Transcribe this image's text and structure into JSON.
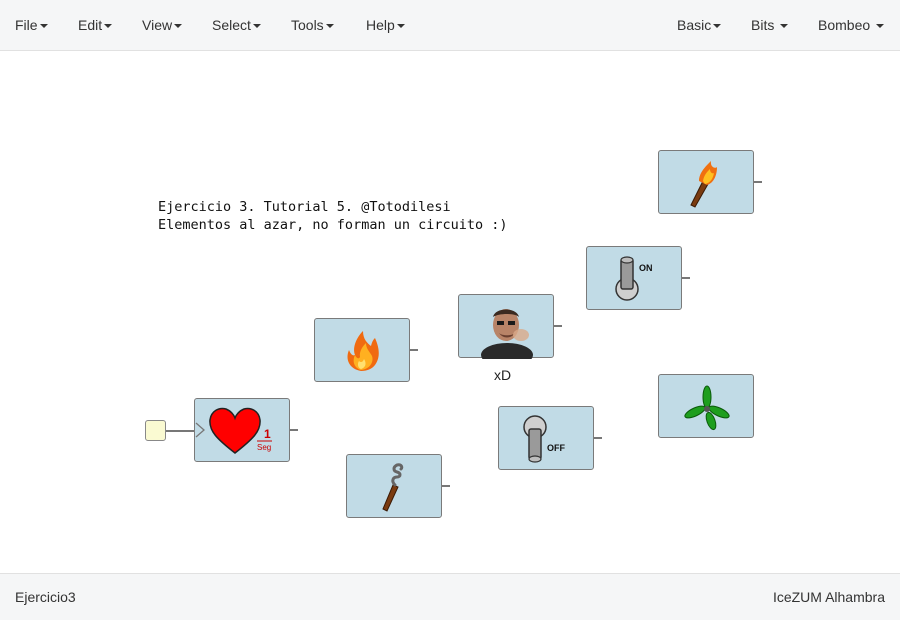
{
  "menu": {
    "left": [
      "File",
      "Edit",
      "View",
      "Select",
      "Tools",
      "Help"
    ],
    "right": [
      "Basic",
      "Bits",
      "Bombeo"
    ]
  },
  "canvas": {
    "comment_line1": "Ejercicio 3. Tutorial 5. @Totodilesi",
    "comment_line2": "Elementos al azar, no forman un circuito :)",
    "photo_label": "xD",
    "heart_value": "1",
    "heart_unit": "Seg",
    "switch_on_label": "ON",
    "switch_off_label": "OFF"
  },
  "footer": {
    "project_name": "Ejercicio3",
    "board_name": "IceZUM Alhambra"
  }
}
